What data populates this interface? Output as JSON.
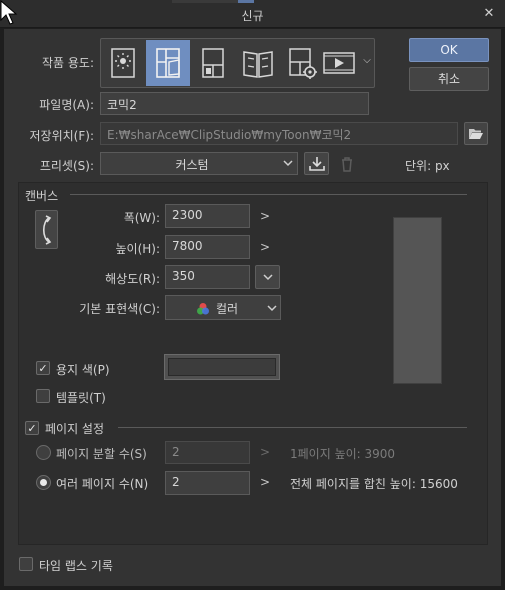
{
  "window": {
    "title": "신규",
    "close_icon": "✕"
  },
  "actions": {
    "ok": "OK",
    "cancel": "취소"
  },
  "usage": {
    "label": "작품 용도:",
    "items": [
      {
        "name": "illustration",
        "selected": false
      },
      {
        "name": "comic",
        "selected": true
      },
      {
        "name": "single-page",
        "selected": false
      },
      {
        "name": "book",
        "selected": false
      },
      {
        "name": "settings-page",
        "selected": false
      },
      {
        "name": "animation",
        "selected": false
      }
    ],
    "dropdown_arrow": "⌵"
  },
  "filename": {
    "label": "파일명(A):",
    "value": "코믹2"
  },
  "location": {
    "label": "저장위치(F):",
    "value": "E:₩sharAce₩ClipStudio₩myToon₩코믹2"
  },
  "preset": {
    "label": "프리셋(S):",
    "value": "커스텀",
    "unit_label": "단위: px"
  },
  "canvas": {
    "section": "캔버스",
    "width_label": "폭(W):",
    "width": "2300",
    "height_label": "높이(H):",
    "height": "7800",
    "resolution_label": "해상도(R):",
    "resolution": "350",
    "color_label": "기본 표현색(C):",
    "color": "컬러",
    "paper_color_label": "용지 색(P)",
    "paper_color_checked": true,
    "paper_color": "#3c3c3c",
    "template_label": "템플릿(T)",
    "template_checked": false
  },
  "page_settings": {
    "label": "페이지 설정",
    "checked": true,
    "split_label": "페이지 분할 수(S)",
    "split_value": "2",
    "split_info": "1페이지 높이: 3900",
    "multi_label": "여러 페이지 수(N)",
    "multi_value": "2",
    "multi_info": "전체 페이지를 합친 높이: 15600",
    "selected": "multi"
  },
  "timelapse": {
    "label": "타임 랩스 기록",
    "checked": false
  }
}
